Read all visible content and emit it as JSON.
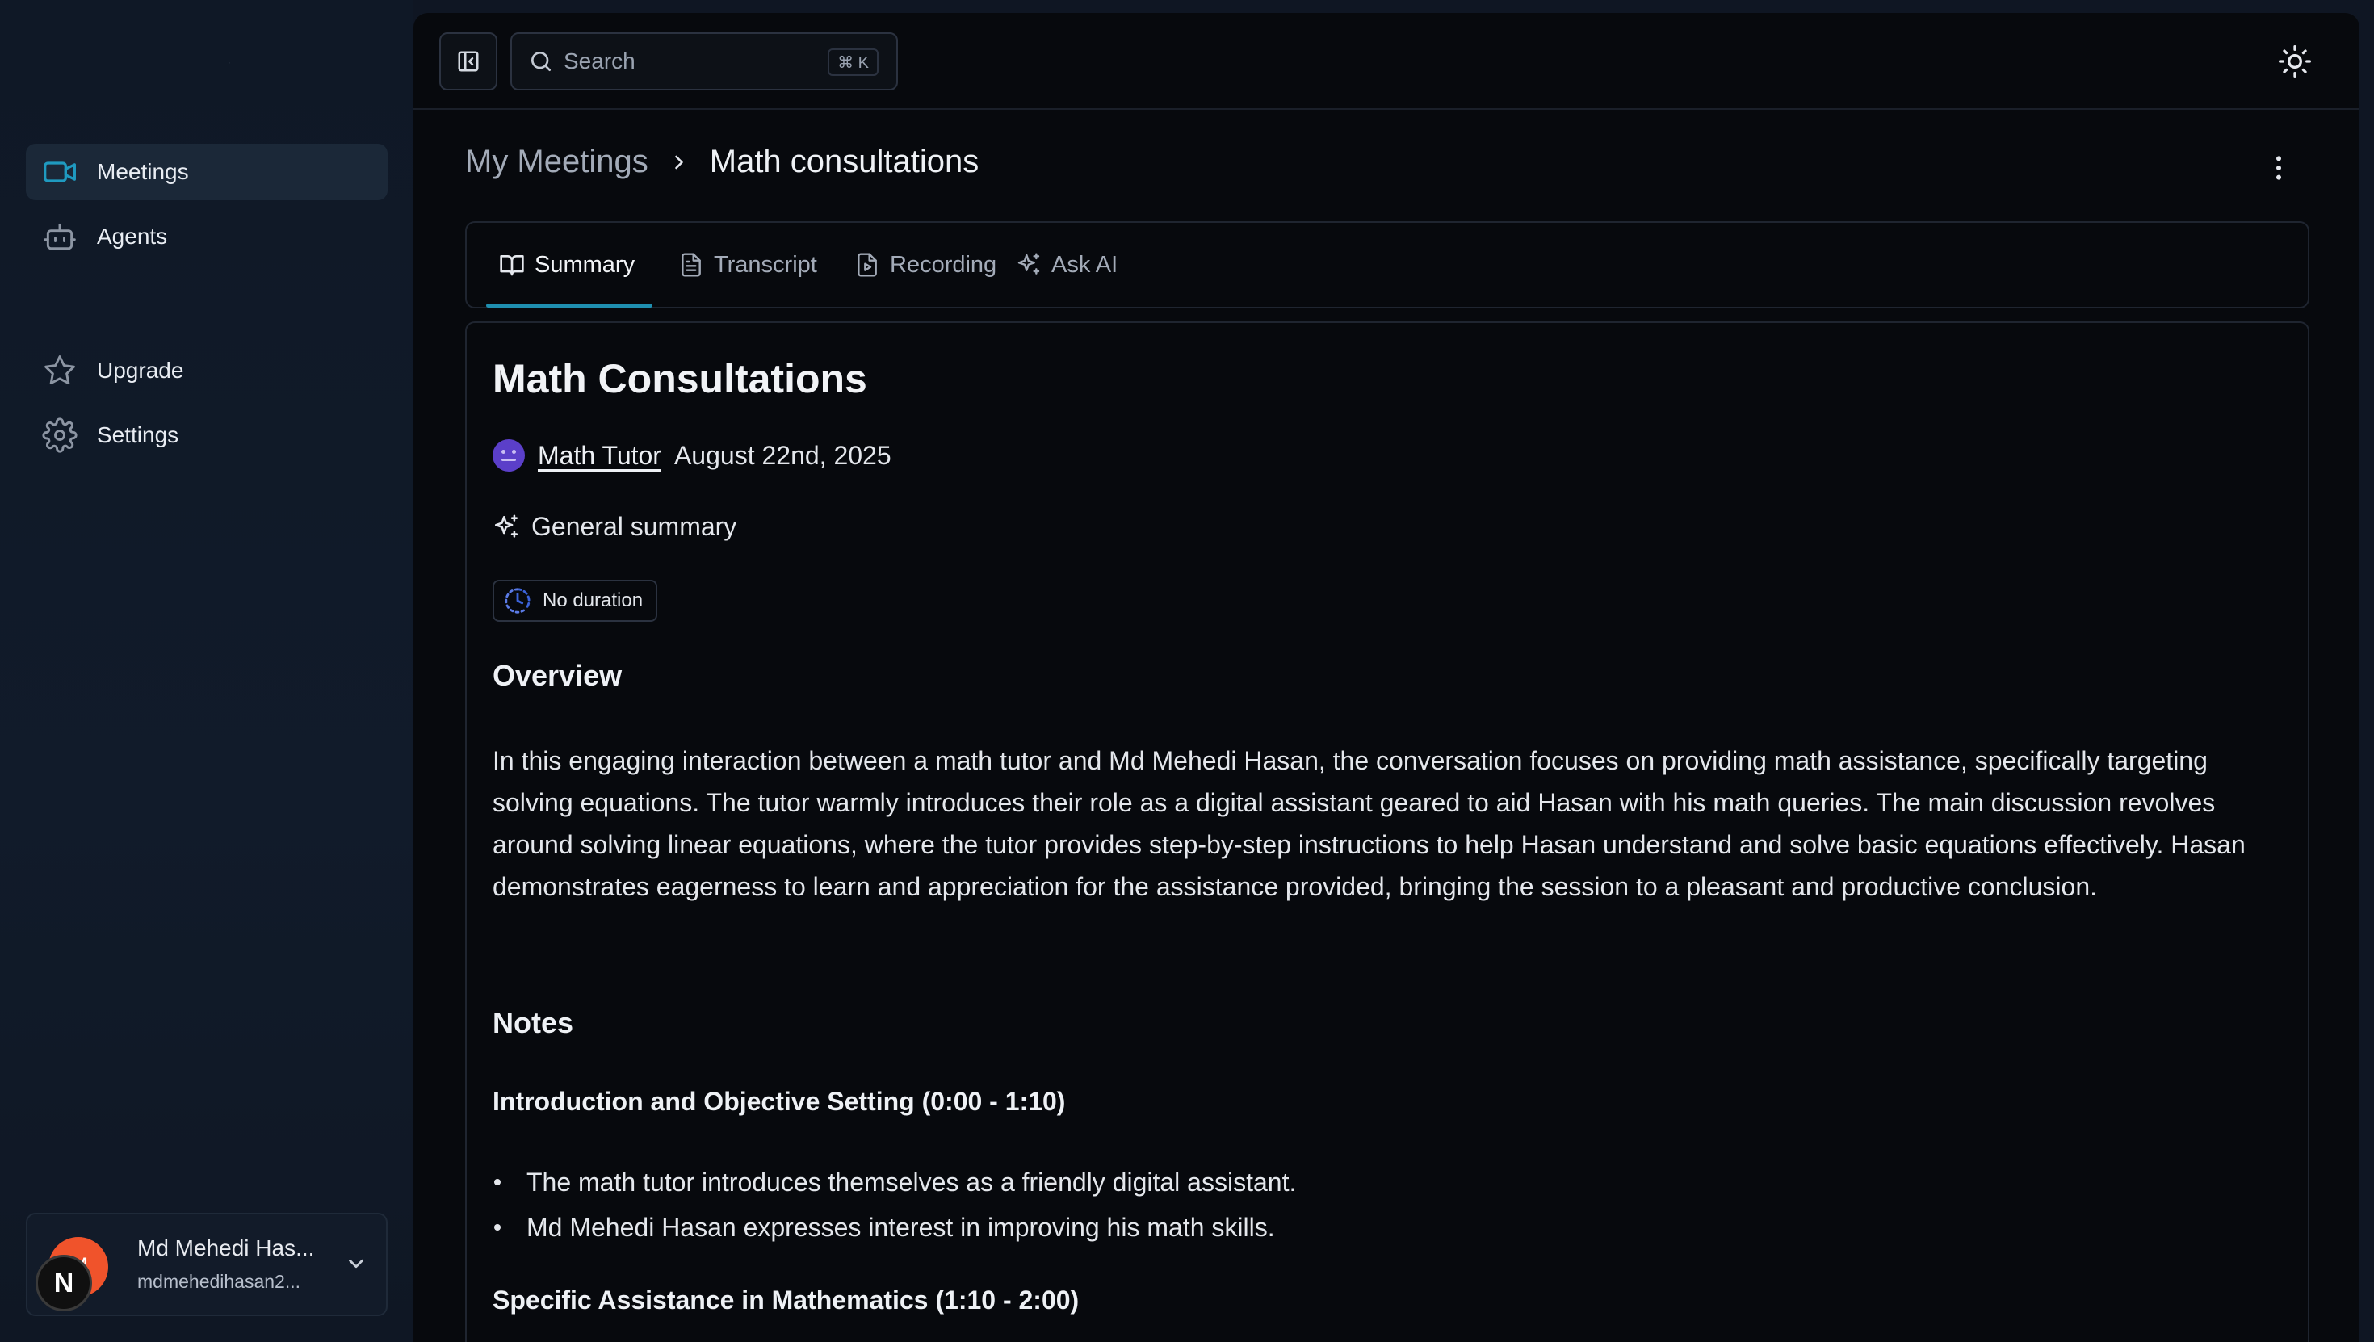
{
  "sidebar": {
    "nav_primary": [
      {
        "label": "Meetings",
        "icon": "video-icon",
        "active": true
      },
      {
        "label": "Agents",
        "icon": "bot-icon",
        "active": false
      }
    ],
    "nav_secondary": [
      {
        "label": "Upgrade",
        "icon": "star-icon"
      },
      {
        "label": "Settings",
        "icon": "gear-icon"
      }
    ],
    "user": {
      "avatar_initial": "M",
      "badge_letter": "N",
      "name": "Md Mehedi Has...",
      "email": "mdmehedihasan2..."
    }
  },
  "topbar": {
    "search_placeholder": "Search",
    "search_shortcut": "⌘ K"
  },
  "breadcrumb": {
    "root": "My Meetings",
    "current": "Math consultations"
  },
  "tabs": [
    {
      "label": "Summary",
      "icon": "book-open-icon",
      "active": true
    },
    {
      "label": "Transcript",
      "icon": "file-text-icon",
      "active": false
    },
    {
      "label": "Recording",
      "icon": "file-video-icon",
      "active": false
    },
    {
      "label": "Ask AI",
      "icon": "sparkles-icon",
      "active": false
    }
  ],
  "meeting": {
    "title": "Math Consultations",
    "agent_name": "Math Tutor",
    "date": "August 22nd, 2025",
    "summary_label": "General summary",
    "duration": "No duration",
    "overview_heading": "Overview",
    "overview_text": "In this engaging interaction between a math tutor and Md Mehedi Hasan, the conversation focuses on providing math assistance, specifically targeting solving equations. The tutor warmly introduces their role as a digital assistant geared to aid Hasan with his math queries. The main discussion revolves around solving linear equations, where the tutor provides step-by-step instructions to help Hasan understand and solve basic equations effectively. Hasan demonstrates eagerness to learn and appreciation for the assistance provided, bringing the session to a pleasant and productive conclusion.",
    "notes_heading": "Notes",
    "sections": [
      {
        "title": "Introduction and Objective Setting (0:00 - 1:10)",
        "bullets": [
          "The math tutor introduces themselves as a friendly digital assistant.",
          "Md Mehedi Hasan expresses interest in improving his math skills."
        ]
      },
      {
        "title": "Specific Assistance in Mathematics (1:10 - 2:00)",
        "bullets": []
      }
    ]
  },
  "colors": {
    "accent": "#1f8fb0",
    "sidebar_bg": "#0f1826",
    "main_bg": "#07090d",
    "user_avatar": "#f0532b",
    "agent_avatar": "#5b3fc9"
  }
}
